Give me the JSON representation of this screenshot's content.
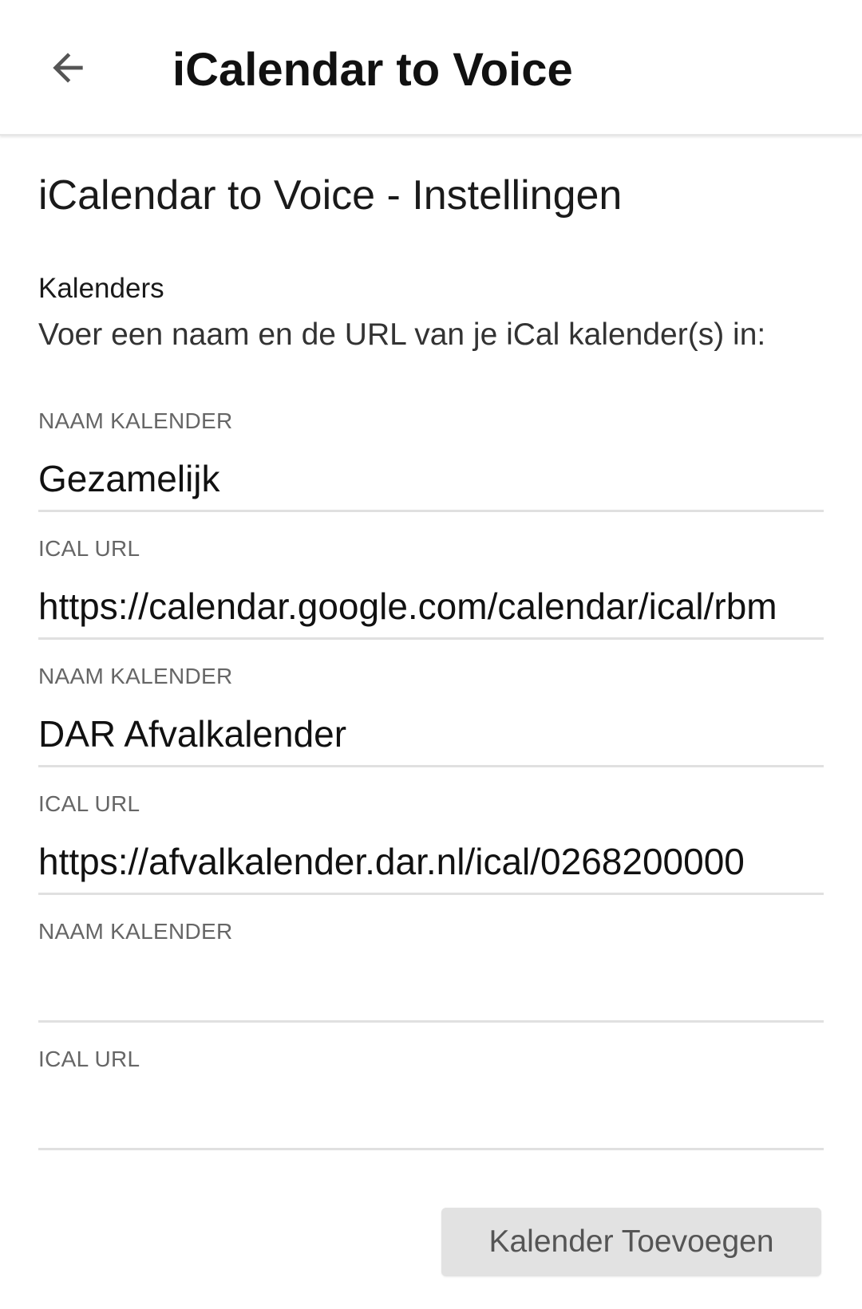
{
  "header": {
    "title": "iCalendar to Voice",
    "back_icon": "arrow-left-icon"
  },
  "page": {
    "title": "iCalendar to Voice - Instellingen",
    "section_label": "Kalenders",
    "section_description": "Voer een naam en de URL van je iCal kalender(s) in:"
  },
  "fields": [
    {
      "label": "NAAM KALENDER",
      "value": "Gezamelijk"
    },
    {
      "label": "ICAL URL",
      "value": "https://calendar.google.com/calendar/ical/rbm"
    },
    {
      "label": "NAAM KALENDER",
      "value": "DAR Afvalkalender"
    },
    {
      "label": "ICAL URL",
      "value": "https://afvalkalender.dar.nl/ical/0268200000"
    },
    {
      "label": "NAAM KALENDER",
      "value": ""
    },
    {
      "label": "ICAL URL",
      "value": ""
    }
  ],
  "actions": {
    "add_calendar_label": "Kalender Toevoegen"
  },
  "colors": {
    "button_bg": "#e2e2e2",
    "divider": "#e0e0e0",
    "label_gray": "#666666"
  }
}
